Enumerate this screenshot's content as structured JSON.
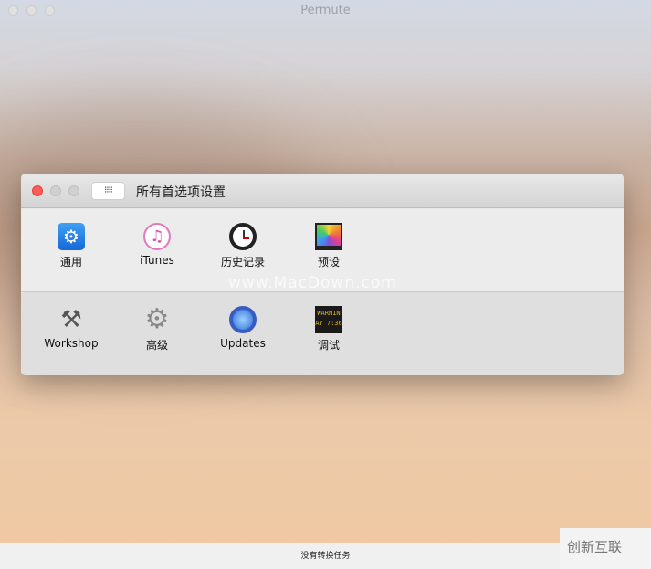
{
  "app_title": "Permute",
  "prefs_window": {
    "title": "所有首选项设置",
    "grid_icon": "grid-icon",
    "row1": [
      {
        "label": "通用",
        "icon": "general-gear-icon"
      },
      {
        "label": "iTunes",
        "icon": "itunes-icon"
      },
      {
        "label": "历史记录",
        "icon": "clock-icon"
      },
      {
        "label": "预设",
        "icon": "monitor-icon"
      }
    ],
    "row2": [
      {
        "label": "Workshop",
        "icon": "tools-icon"
      },
      {
        "label": "高级",
        "icon": "gear-icon"
      },
      {
        "label": "Updates",
        "icon": "updates-icon"
      },
      {
        "label": "调试",
        "icon": "console-icon"
      }
    ],
    "console_text": "WARNIN AY 7:36"
  },
  "status": "没有转换任务",
  "watermark": "www.MacDown.com",
  "corner_logo": "创新互联"
}
